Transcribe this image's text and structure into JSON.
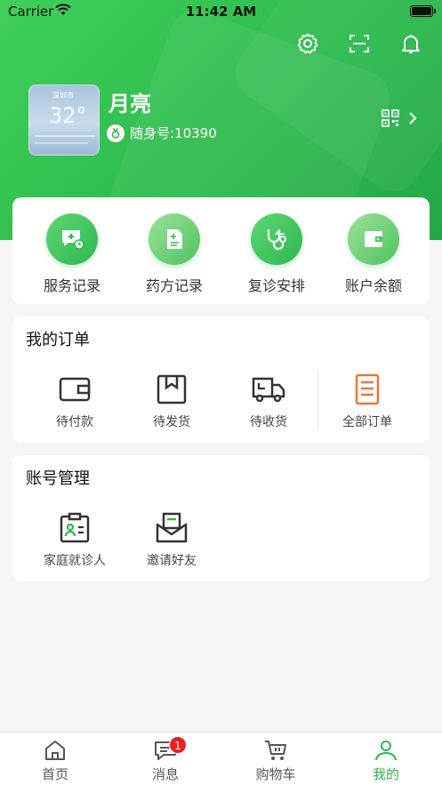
{
  "status_bar": {
    "carrier": "Carrier",
    "time": "11:42 AM"
  },
  "header_icons": [
    "gear-icon",
    "scan-icon",
    "bell-icon"
  ],
  "profile": {
    "name": "月亮",
    "id_label": "随身号:10390",
    "avatar_weather": {
      "city": "深圳市",
      "temp": "32°"
    }
  },
  "services": [
    {
      "label": "服务记录",
      "icon": "service-record-icon"
    },
    {
      "label": "药方记录",
      "icon": "prescription-icon"
    },
    {
      "label": "复诊安排",
      "icon": "stethoscope-icon"
    },
    {
      "label": "账户余额",
      "icon": "wallet-icon"
    }
  ],
  "orders": {
    "title": "我的订单",
    "items": [
      {
        "label": "待付款",
        "icon": "wallet-outline-icon"
      },
      {
        "label": "待发货",
        "icon": "box-icon"
      },
      {
        "label": "待收货",
        "icon": "truck-icon"
      },
      {
        "label": "全部订单",
        "icon": "order-list-icon"
      }
    ]
  },
  "account": {
    "title": "账号管理",
    "items": [
      {
        "label": "家庭就诊人",
        "icon": "family-patient-icon"
      },
      {
        "label": "邀请好友",
        "icon": "invite-mail-icon"
      }
    ]
  },
  "tabbar": {
    "items": [
      {
        "label": "首页",
        "icon": "home-icon"
      },
      {
        "label": "消息",
        "icon": "message-icon",
        "badge": "1"
      },
      {
        "label": "购物车",
        "icon": "cart-icon"
      },
      {
        "label": "我的",
        "icon": "person-icon",
        "active": true
      }
    ]
  },
  "colors": {
    "brand_green": "#2db84d",
    "badge_red": "#f01e1e",
    "order_accent": "#f0733a"
  }
}
